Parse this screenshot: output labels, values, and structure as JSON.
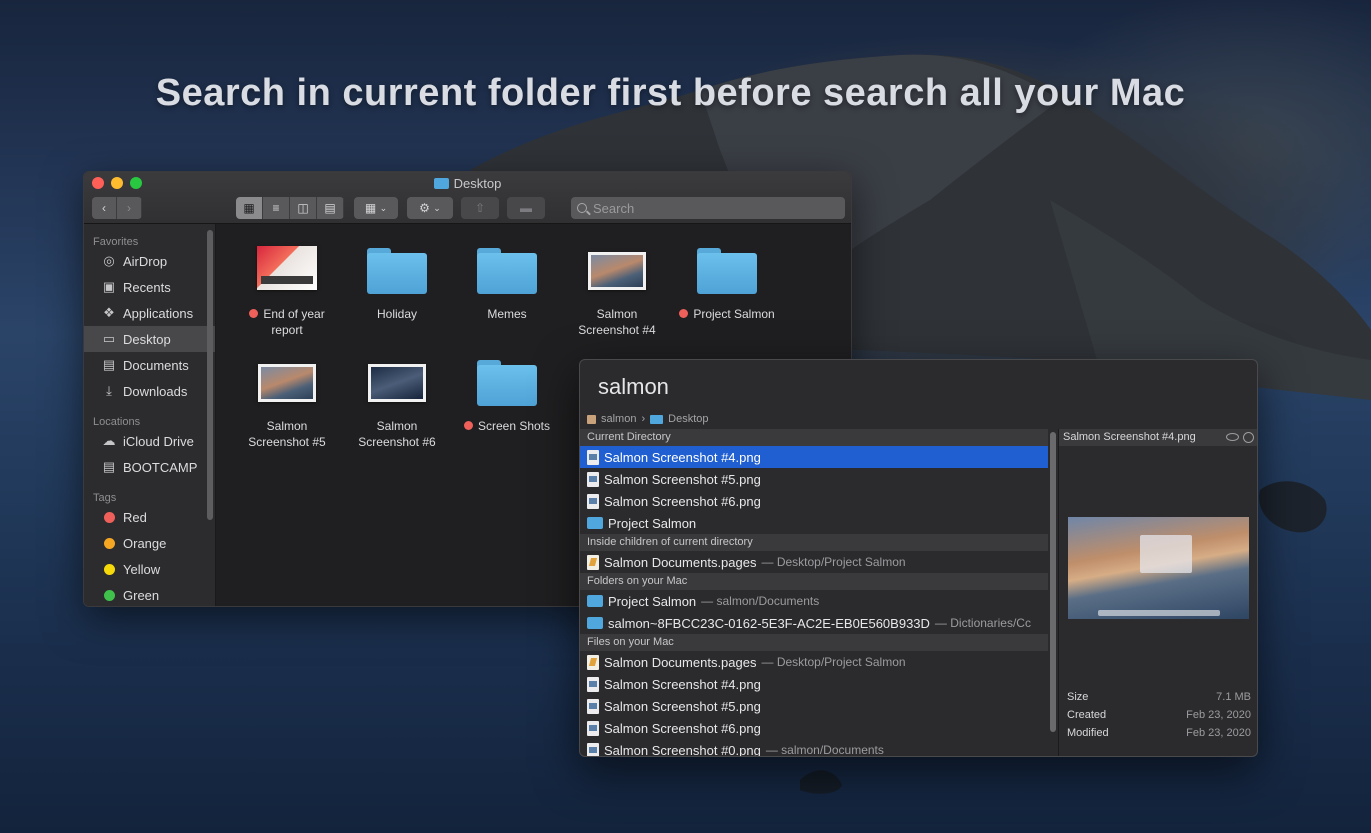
{
  "headline": "Search in current folder first before search all your Mac",
  "finder": {
    "title": "Desktop",
    "search_placeholder": "Search",
    "sidebar": {
      "favorites_header": "Favorites",
      "favorites": [
        {
          "label": "AirDrop",
          "icon": "airdrop-icon"
        },
        {
          "label": "Recents",
          "icon": "clock-icon"
        },
        {
          "label": "Applications",
          "icon": "applications-icon"
        },
        {
          "label": "Desktop",
          "icon": "desktop-icon",
          "selected": true
        },
        {
          "label": "Documents",
          "icon": "document-icon"
        },
        {
          "label": "Downloads",
          "icon": "download-icon"
        }
      ],
      "locations_header": "Locations",
      "locations": [
        {
          "label": "iCloud Drive",
          "icon": "cloud-icon"
        },
        {
          "label": "BOOTCAMP",
          "icon": "drive-icon"
        }
      ],
      "tags_header": "Tags",
      "tags": [
        {
          "label": "Red",
          "color": "#f0605a"
        },
        {
          "label": "Orange",
          "color": "#f5a623"
        },
        {
          "label": "Yellow",
          "color": "#f5d90a"
        },
        {
          "label": "Green",
          "color": "#3fc14b"
        }
      ]
    },
    "files": [
      {
        "line1": "End of year",
        "line2": "report",
        "kind": "report",
        "tag": true
      },
      {
        "line1": "Holiday",
        "line2": "",
        "kind": "folder",
        "tag": false
      },
      {
        "line1": "Memes",
        "line2": "",
        "kind": "folder",
        "tag": false
      },
      {
        "line1": "Salmon",
        "line2": "Screenshot #4",
        "kind": "image",
        "tag": false
      },
      {
        "line1": "Project Salmon",
        "line2": "",
        "kind": "folder",
        "tag": true
      },
      {
        "line1": "Salmon",
        "line2": "Screenshot #5",
        "kind": "image",
        "tag": false
      },
      {
        "line1": "Salmon",
        "line2": "Screenshot #6",
        "kind": "image",
        "tag": false
      },
      {
        "line1": "Screen Shots",
        "line2": "",
        "kind": "folder",
        "tag": true
      }
    ]
  },
  "search_panel": {
    "query": "salmon",
    "breadcrumb": [
      "salmon",
      "Desktop"
    ],
    "sections": [
      {
        "header": "Current Directory",
        "rows": [
          {
            "name": "Salmon Screenshot #4.png",
            "icon": "png-icon",
            "path": "",
            "selected": true
          },
          {
            "name": "Salmon Screenshot #5.png",
            "icon": "png-icon",
            "path": ""
          },
          {
            "name": "Salmon Screenshot #6.png",
            "icon": "png-icon",
            "path": ""
          },
          {
            "name": "Project Salmon",
            "icon": "folder-icon",
            "path": ""
          }
        ]
      },
      {
        "header": "Inside children of current directory",
        "rows": [
          {
            "name": "Salmon Documents.pages",
            "icon": "pages-icon",
            "path": "— Desktop/Project Salmon"
          }
        ]
      },
      {
        "header": "Folders on your Mac",
        "rows": [
          {
            "name": "Project Salmon",
            "icon": "folder-icon",
            "path": "— salmon/Documents"
          },
          {
            "name": "salmon~8FBCC23C-0162-5E3F-AC2E-EB0E560B933D",
            "icon": "folder-icon",
            "path": "— Dictionaries/Cc"
          }
        ]
      },
      {
        "header": "Files on your Mac",
        "rows": [
          {
            "name": "Salmon Documents.pages",
            "icon": "pages-icon",
            "path": "— Desktop/Project Salmon"
          },
          {
            "name": "Salmon Screenshot #4.png",
            "icon": "png-icon",
            "path": ""
          },
          {
            "name": "Salmon Screenshot #5.png",
            "icon": "png-icon",
            "path": ""
          },
          {
            "name": "Salmon Screenshot #6.png",
            "icon": "png-icon",
            "path": ""
          },
          {
            "name": "Salmon Screenshot #0.png",
            "icon": "png-icon",
            "path": "— salmon/Documents"
          }
        ]
      }
    ],
    "preview": {
      "title": "Salmon Screenshot #4.png",
      "size_label": "Size",
      "size_value": "7.1 MB",
      "created_label": "Created",
      "created_value": "Feb 23, 2020",
      "modified_label": "Modified",
      "modified_value": "Feb 23, 2020"
    }
  }
}
